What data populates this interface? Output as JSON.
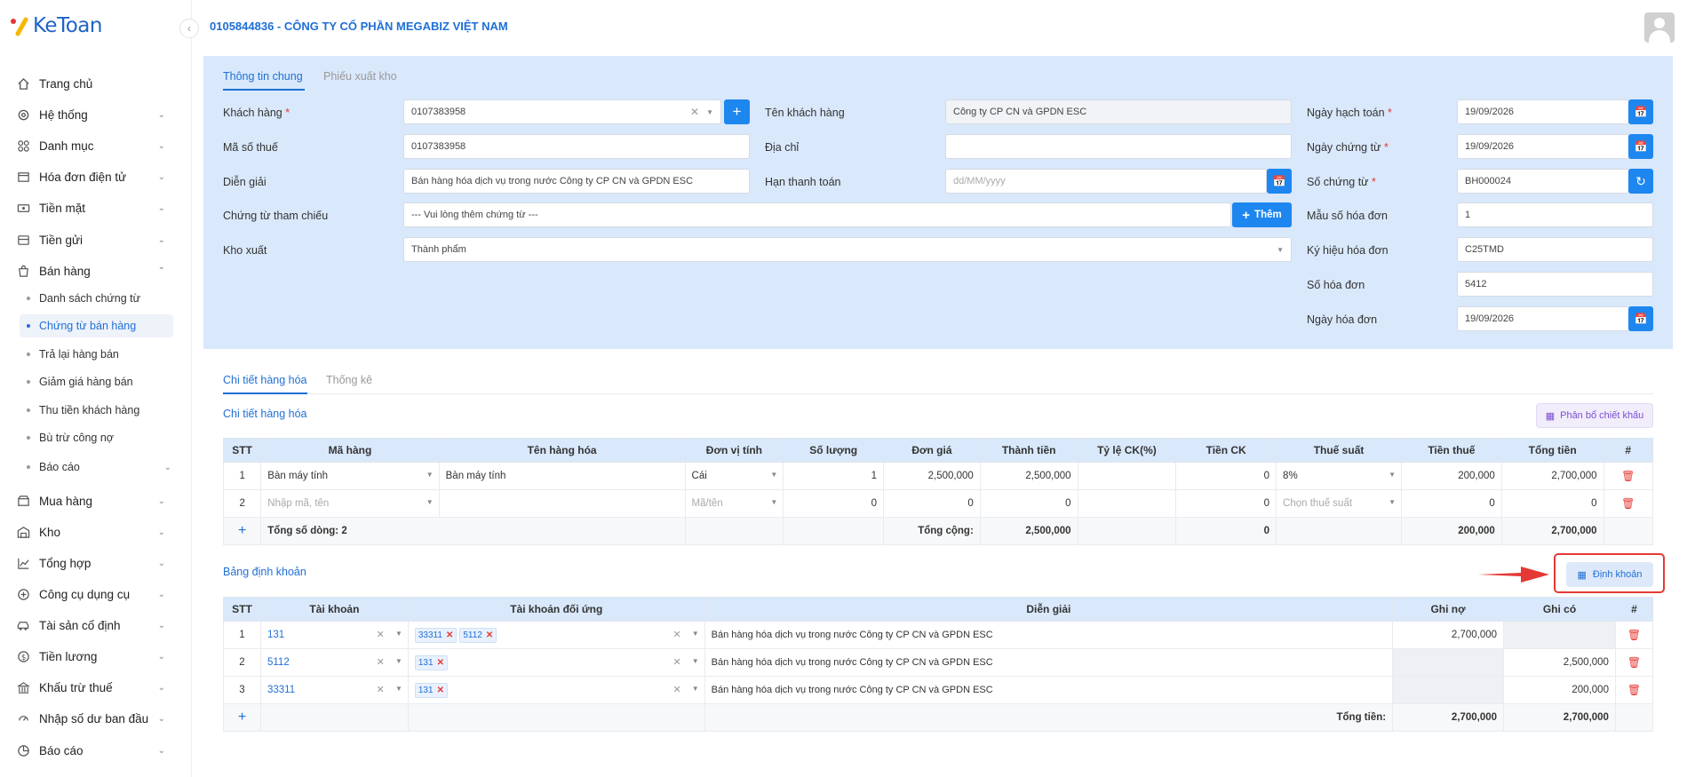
{
  "app": {
    "logo_text": "KeToan",
    "company": "0105844836 - CÔNG TY CỔ PHẦN MEGABIZ VIỆT NAM"
  },
  "sidebar": {
    "items": [
      {
        "label": "Trang chủ",
        "icon": "home-icon",
        "chev": false
      },
      {
        "label": "Hệ thống",
        "icon": "gear-icon",
        "chev": true
      },
      {
        "label": "Danh mục",
        "icon": "grid-icon",
        "chev": true
      },
      {
        "label": "Hóa đơn điện tử",
        "icon": "invoice-icon",
        "chev": true
      },
      {
        "label": "Tiền mặt",
        "icon": "cash-icon",
        "chev": true
      },
      {
        "label": "Tiền gửi",
        "icon": "bank-icon",
        "chev": true
      },
      {
        "label": "Bán hàng",
        "icon": "cart-icon",
        "chev": true,
        "open": true
      }
    ],
    "sub_items": [
      "Danh sách chứng từ",
      "Chứng từ bán hàng",
      "Trả lại hàng bán",
      "Giảm giá hàng bán",
      "Thu tiền khách hàng",
      "Bù trừ công nợ",
      "Báo cáo"
    ],
    "items2": [
      {
        "label": "Mua hàng",
        "icon": "purchase-icon"
      },
      {
        "label": "Kho",
        "icon": "warehouse-icon"
      },
      {
        "label": "Tổng hợp",
        "icon": "chart-icon"
      },
      {
        "label": "Công cụ dụng cụ",
        "icon": "tools-icon"
      },
      {
        "label": "Tài sản cố định",
        "icon": "car-icon"
      },
      {
        "label": "Tiền lương",
        "icon": "salary-icon"
      },
      {
        "label": "Khấu trừ thuế",
        "icon": "tax-icon"
      },
      {
        "label": "Nhập số dư ban đầu",
        "icon": "balance-icon"
      },
      {
        "label": "Báo cáo",
        "icon": "report-icon"
      }
    ]
  },
  "header": {
    "tabs": [
      "Thông tin chung",
      "Phiếu xuất kho"
    ],
    "customer_label": "Khách hàng",
    "customer_value": "0107383958",
    "tax_label": "Mã số thuế",
    "tax_value": "0107383958",
    "desc_label": "Diễn giải",
    "desc_value": "Bán hàng hóa dịch vụ trong nước Công ty CP CN và GPDN ESC",
    "ref_label": "Chứng từ tham chiếu",
    "ref_placeholder": "--- Vui lòng thêm chứng từ ---",
    "add_label": "Thêm",
    "wh_label": "Kho xuất",
    "wh_value": "Thành phẩm",
    "cust_name_label": "Tên khách hàng",
    "cust_name_value": "Công ty CP CN và GPDN ESC",
    "addr_label": "Địa chỉ",
    "addr_value": "",
    "due_label": "Hạn thanh toán",
    "due_placeholder": "dd/MM/yyyy",
    "post_date_label": "Ngày hạch toán",
    "post_date_value": "19/09/2026",
    "doc_date_label": "Ngày chứng từ",
    "doc_date_value": "19/09/2026",
    "doc_no_label": "Số chứng từ",
    "doc_no_value": "BH000024",
    "inv_form_label": "Mẫu số hóa đơn",
    "inv_form_value": "1",
    "inv_sym_label": "Ký hiệu hóa đơn",
    "inv_sym_value": "C25TMD",
    "inv_no_label": "Số hóa đơn",
    "inv_no_value": "5412",
    "inv_date_label": "Ngày hóa đơn",
    "inv_date_value": "19/09/2026"
  },
  "detail": {
    "tabs": [
      "Chi tiết hàng hóa",
      "Thống kê"
    ],
    "section_title": "Chi tiết hàng hóa",
    "discount_btn": "Phân bổ chiết khấu",
    "columns": [
      "STT",
      "Mã hàng",
      "Tên hàng hóa",
      "Đơn vị tính",
      "Số lượng",
      "Đơn giá",
      "Thành tiền",
      "Tỷ lệ CK(%)",
      "Tiền CK",
      "Thuế suất",
      "Tiền thuế",
      "Tổng tiền",
      "#"
    ],
    "rows": [
      {
        "stt": "1",
        "code": "Bàn máy tính",
        "name": "Bàn máy tính",
        "unit": "Cái",
        "qty": "1",
        "price": "2,500,000",
        "amount": "2,500,000",
        "ck_rate": "",
        "ck": "0",
        "vat": "8%",
        "tax": "200,000",
        "total": "2,700,000"
      },
      {
        "stt": "2",
        "code": "Nhập mã, tên",
        "name": "",
        "unit": "Mã/tên",
        "qty": "0",
        "price": "0",
        "amount": "0",
        "ck_rate": "",
        "ck": "0",
        "vat": "Chọn thuế suất",
        "tax": "0",
        "total": "0"
      }
    ],
    "footer": {
      "row_count": "Tổng số dòng: 2",
      "sum_label": "Tổng cộng:",
      "amount": "2,500,000",
      "ck": "0",
      "tax": "200,000",
      "total": "2,700,000"
    }
  },
  "journal": {
    "title": "Bảng định khoản",
    "btn": "Định khoản",
    "columns": [
      "STT",
      "Tài khoản",
      "Tài khoản đối ứng",
      "Diễn giải",
      "Ghi nợ",
      "Ghi có",
      "#"
    ],
    "rows": [
      {
        "stt": "1",
        "acc": "131",
        "contra": [
          "33311",
          "5112"
        ],
        "desc": "Bán hàng hóa dịch vụ trong nước Công ty CP CN và GPDN ESC",
        "debit": "2,700,000",
        "credit": ""
      },
      {
        "stt": "2",
        "acc": "5112",
        "contra": [
          "131"
        ],
        "desc": "Bán hàng hóa dịch vụ trong nước Công ty CP CN và GPDN ESC",
        "debit": "",
        "credit": "2,500,000"
      },
      {
        "stt": "3",
        "acc": "33311",
        "contra": [
          "131"
        ],
        "desc": "Bán hàng hóa dịch vụ trong nước Công ty CP CN và GPDN ESC",
        "debit": "",
        "credit": "200,000"
      }
    ],
    "footer": {
      "label": "Tổng tiền:",
      "debit": "2,700,000",
      "credit": "2,700,000"
    }
  },
  "colors": {
    "accent": "#1e86ef",
    "header_bg": "#d9e8fb",
    "highlight": "#e53935"
  }
}
